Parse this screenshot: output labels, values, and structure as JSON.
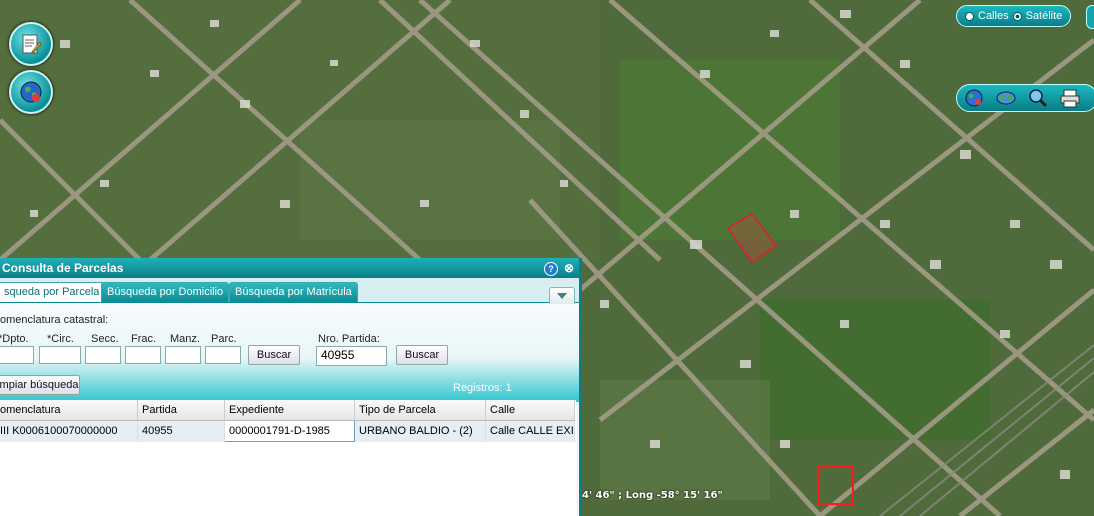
{
  "layer_toggle": {
    "option_streets": "Calles",
    "option_satellite": "Satélite",
    "selected": "Satélite"
  },
  "map_icons": {
    "left_buttons": [
      "document-icon",
      "globe-icon"
    ],
    "toolbar": [
      "globe-icon",
      "world-map-icon",
      "zoom-icon",
      "print-icon"
    ]
  },
  "coordinates_text": "4' 46\" ; Long -58° 15' 16\"",
  "panel": {
    "title": "Consulta de Parcelas",
    "help_icon": "?",
    "close_icon": "⊗",
    "tabs": [
      "squeda por Parcela",
      "Búsqueda por Domicilio",
      "Búsqueda por Matrícula"
    ],
    "active_tab": 0,
    "nomenclatura_label": "omenclatura catastral:",
    "fields": [
      {
        "label": "*Dpto.",
        "value": ""
      },
      {
        "label": "*Circ.",
        "value": ""
      },
      {
        "label": "Secc.",
        "value": ""
      },
      {
        "label": "Frac.",
        "value": ""
      },
      {
        "label": "Manz.",
        "value": ""
      },
      {
        "label": "Parc.",
        "value": ""
      }
    ],
    "search_button": "Buscar",
    "partida_label": "Nro. Partida:",
    "partida_value": "40955",
    "partida_search_button": "Buscar",
    "clear_button": "mpiar búsqueda",
    "records_label": "Registros: 1",
    "table": {
      "columns": [
        "omenclatura",
        "Partida",
        "Expediente",
        "Tipo de Parcela",
        "Calle"
      ],
      "rows": [
        [
          "III  K0006100070000000",
          "40955",
          "0000001791-D-1985",
          "URBANO BALDIO - (2)",
          "Calle CALLE EXIS"
        ]
      ]
    }
  }
}
